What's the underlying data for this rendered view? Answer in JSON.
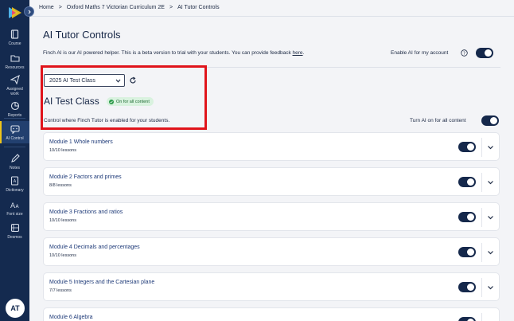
{
  "app": {
    "avatar_initials": "AT"
  },
  "sidebar": {
    "items": [
      {
        "label": "Course",
        "icon": "book-icon",
        "active": false
      },
      {
        "label": "Resources",
        "icon": "folder-icon",
        "active": false
      },
      {
        "label": "Assigned work",
        "icon": "paper-plane-icon",
        "active": false
      },
      {
        "label": "Reports",
        "icon": "chart-icon",
        "active": false
      },
      {
        "label": "AI Control",
        "icon": "ai-chat-icon",
        "active": true
      },
      {
        "label": "Notes",
        "icon": "pencil-icon",
        "active": false
      },
      {
        "label": "Dictionary",
        "icon": "dictionary-icon",
        "active": false
      },
      {
        "label": "Font size",
        "icon": "font-size-icon",
        "active": false
      },
      {
        "label": "Desmos",
        "icon": "desmos-icon",
        "active": false
      }
    ]
  },
  "breadcrumb": {
    "items": [
      "Home",
      "Oxford Maths 7 Victorian Curriculum 2E",
      "AI Tutor Controls"
    ],
    "separator": ">"
  },
  "page": {
    "title": "AI Tutor Controls",
    "intro_text": "Finch AI is our AI powered helper. This is a beta version to trial with your students. You can provide feedback ",
    "intro_link": "here",
    "intro_end": ".",
    "enable_label": "Enable AI for my account",
    "enable_on": true
  },
  "class_panel": {
    "selected_class": "2025 AI Test Class",
    "class_name": "AI Test Class",
    "status_badge": "On for all content",
    "description": "Control where Finch Tutor is enabled for your students.",
    "turn_on_all_label": "Turn AI on for all content",
    "all_on": true
  },
  "modules": [
    {
      "title": "Module 1 Whole numbers",
      "lessons": "10/10 lessons",
      "on": true
    },
    {
      "title": "Module 2 Factors and primes",
      "lessons": "8/8 lessons",
      "on": true
    },
    {
      "title": "Module 3 Fractions and ratios",
      "lessons": "10/10 lessons",
      "on": true
    },
    {
      "title": "Module 4 Decimals and percentages",
      "lessons": "10/10 lessons",
      "on": true
    },
    {
      "title": "Module 5 Integers and the Cartesian plane",
      "lessons": "7/7 lessons",
      "on": true
    },
    {
      "title": "Module 6 Algebra",
      "lessons": "",
      "on": true
    }
  ],
  "colors": {
    "sidebar": "#142a4f",
    "toggle_on": "#15284b",
    "highlight": "#e0141b",
    "badge_bg": "#d9f2df",
    "module_title": "#1e3a78"
  }
}
